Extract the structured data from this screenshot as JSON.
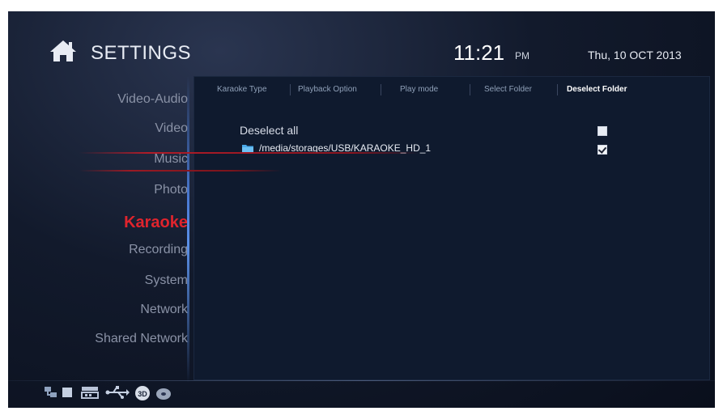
{
  "header": {
    "title": "SETTINGS",
    "time": "11:21",
    "ampm": "PM",
    "date": "Thu, 10 OCT 2013",
    "icon": "home-icon"
  },
  "sidebar": {
    "items": [
      {
        "label": "Video-Audio",
        "active": false
      },
      {
        "label": "Video",
        "active": false
      },
      {
        "label": "Music",
        "active": false
      },
      {
        "label": "Photo",
        "active": false
      },
      {
        "label": "Karaoke",
        "active": true
      },
      {
        "label": "Recording",
        "active": false
      },
      {
        "label": "System",
        "active": false
      },
      {
        "label": "Network",
        "active": false
      },
      {
        "label": "Shared Network",
        "active": false
      }
    ],
    "active_color": "#e0242d"
  },
  "tabs": [
    {
      "label": "Karaoke Type",
      "active": false
    },
    {
      "label": "Playback Option",
      "active": false
    },
    {
      "label": "Play mode",
      "active": false
    },
    {
      "label": "Select Folder",
      "active": false
    },
    {
      "label": "Deselect Folder",
      "active": true
    }
  ],
  "list": {
    "deselect_all": {
      "label": "Deselect all",
      "checked": false
    },
    "folders": [
      {
        "path": "/media/storages/USB/KARAOKE_HD_1",
        "checked": true,
        "icon": "folder-icon"
      }
    ]
  },
  "status_bar": {
    "icons": [
      "network-icon",
      "storage-icon",
      "sd-card-icon",
      "usb-icon",
      "3d-icon",
      "disc-icon"
    ]
  }
}
